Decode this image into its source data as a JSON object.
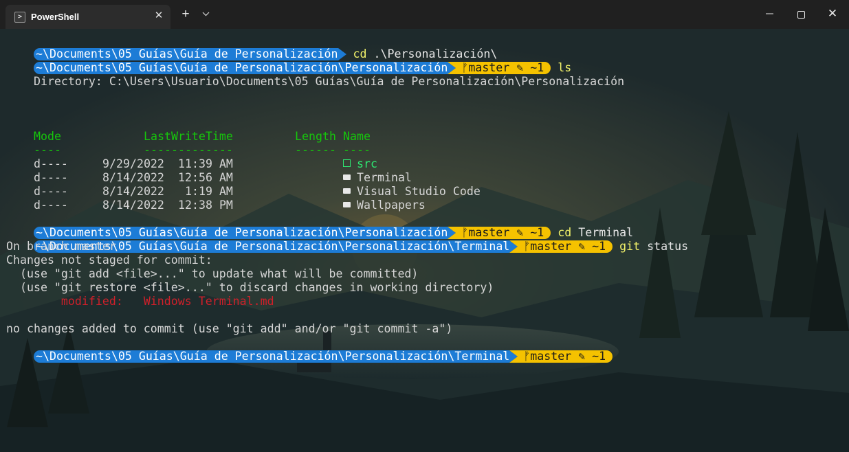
{
  "window": {
    "tab_title": "PowerShell",
    "tab_icon": "powershell-icon",
    "new_tab_label": "+",
    "dropdown_label": "⌄",
    "minimize_label": "—",
    "close_label": "✕"
  },
  "colors": {
    "path_segment": "#1d7cd6",
    "git_segment": "#f5c200",
    "header_green": "#16c60c",
    "modified_red": "#d0202a"
  },
  "terminal": {
    "l1_path": "~\\Documents\\05 Guías\\Guía de Personalización",
    "l1_cmd": "cd",
    "l1_arg": " .\\Personalización\\",
    "l2_path": "~\\Documents\\05 Guías\\Guía de Personalización\\Personalización",
    "l2_git": "ᚠmaster ✎ ~1",
    "l2_cmd": "ls",
    "dir_line": "    Directory: C:\\Users\\Usuario\\Documents\\05 Guías\\Guía de Personalización\\Personalización",
    "hdr_mode": "Mode",
    "hdr_lwt": "LastWriteTime",
    "hdr_length": "Length",
    "hdr_name": "Name",
    "ul_mode": "----",
    "ul_lwt": "-------------",
    "ul_length": "------",
    "ul_name": "----",
    "rows": [
      {
        "mode": "d----",
        "date": "9/29/2022",
        "time": "11:39 AM",
        "name": "src"
      },
      {
        "mode": "d----",
        "date": "8/14/2022",
        "time": "12:56 AM",
        "name": "Terminal"
      },
      {
        "mode": "d----",
        "date": "8/14/2022",
        "time": " 1:19 AM",
        "name": "Visual Studio Code"
      },
      {
        "mode": "d----",
        "date": "8/14/2022",
        "time": "12:38 PM",
        "name": "Wallpapers"
      }
    ],
    "l3_path": "~\\Documents\\05 Guías\\Guía de Personalización\\Personalización",
    "l3_git": "ᚠmaster ✎ ~1",
    "l3_cmd": "cd",
    "l3_arg": " Terminal",
    "l4_path": "~\\Documents\\05 Guías\\Guía de Personalización\\Personalización\\Terminal",
    "l4_git": "ᚠmaster ✎ ~1",
    "l4_cmd": "git",
    "l4_arg": " status",
    "out1": "On branch master",
    "out2": "Changes not staged for commit:",
    "out3": "  (use \"git add <file>...\" to update what will be committed)",
    "out4": "  (use \"git restore <file>...\" to discard changes in working directory)",
    "out5_label": "        modified:   ",
    "out5_file": "Windows Terminal.md",
    "out6": "no changes added to commit (use \"git add\" and/or \"git commit -a\")",
    "l5_path": "~\\Documents\\05 Guías\\Guía de Personalización\\Personalización\\Terminal",
    "l5_git": "ᚠmaster ✎ ~1"
  }
}
